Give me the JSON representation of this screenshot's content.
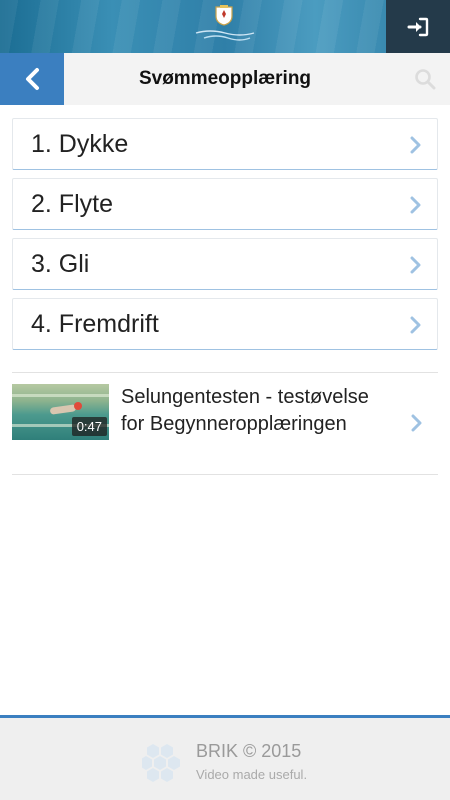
{
  "header": {
    "login_icon": "sign-in-icon",
    "back_icon": "chevron-left-icon",
    "title": "Svømmeopplæring",
    "search_icon": "search-icon"
  },
  "lessons": [
    {
      "label": "1. Dykke",
      "icon": "chevron-right-icon"
    },
    {
      "label": "2. Flyte",
      "icon": "chevron-right-icon"
    },
    {
      "label": "3. Gli",
      "icon": "chevron-right-icon"
    },
    {
      "label": "4. Fremdrift",
      "icon": "chevron-right-icon"
    }
  ],
  "video": {
    "title_line1": "Selungentesten - testøvelse",
    "title_line2": "for Begynneropplæringen",
    "duration": "0:47"
  },
  "footer": {
    "brand": "BRIK © 2015",
    "tagline": "Video made useful."
  },
  "colors": {
    "accent": "#3b7fc0",
    "login_bg": "#243a4a",
    "chevron": "#9fc2e2"
  }
}
